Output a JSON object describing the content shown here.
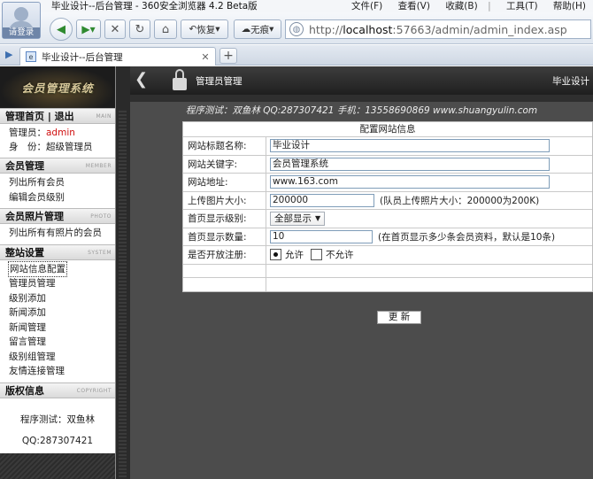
{
  "browser": {
    "title": "毕业设计--后台管理 - 360安全浏览器 4.2 Beta版",
    "menus": [
      "文件(F)",
      "查看(V)",
      "收藏(B)",
      "工具(T)",
      "帮助(H)"
    ],
    "avatar_label": "请登录",
    "restore_label": "恢复",
    "notrace_label": "无痕",
    "address_prefix": "http://",
    "address_host": "localhost",
    "address_rest": ":57663/admin/admin_index.asp",
    "tab_title": "毕业设计--后台管理"
  },
  "sidebar": {
    "logo": "会员管理系统",
    "sections": {
      "home": {
        "title": "管理首页 | 退出",
        "en": "MAIN"
      },
      "member": {
        "title": "会员管理",
        "en": "MEMBER",
        "items": [
          "列出所有会员",
          "编辑会员级别"
        ]
      },
      "photo": {
        "title": "会员照片管理",
        "en": "PHOTO",
        "items": [
          "列出所有有照片的会员"
        ]
      },
      "system": {
        "title": "整站设置",
        "en": "SYSTEM",
        "items": [
          "网站信息配置",
          "管理员管理",
          "级别添加",
          "新闻添加",
          "新闻管理",
          "留言管理",
          "级别组管理",
          "友情连接管理"
        ]
      },
      "copyright": {
        "title": "版权信息",
        "en": "COPYRIGHT",
        "lines": [
          "程序测试：双鱼林",
          "QQ:287307421"
        ]
      }
    },
    "admin_label": "管理员：",
    "admin_value": "admin",
    "role_label": "身　份：",
    "role_value": "超级管理员"
  },
  "header": {
    "title": "管理员管理",
    "right": "毕业设计",
    "contact": "程序测试：双鱼林   QQ:287307421   手机：13558690869 www.shuangyulin.com"
  },
  "config": {
    "caption": "配置网站信息",
    "site_title_label": "网站标题名称:",
    "site_title_value": "毕业设计",
    "keywords_label": "网站关键字:",
    "keywords_value": "会员管理系统",
    "url_label": "网站地址:",
    "url_value": "www.163.com",
    "upload_label": "上传图片大小:",
    "upload_value": "200000",
    "upload_hint": "(队员上传照片大小：200000为200K)",
    "level_label": "首页显示级别:",
    "level_value": "全部显示",
    "count_label": "首页显示数量:",
    "count_value": "10",
    "count_hint": "(在首页显示多少条会员资料，默认是10条)",
    "register_label": "是否开放注册:",
    "register_yes": "允许",
    "register_no": "不允许",
    "submit_label": "更  新"
  }
}
